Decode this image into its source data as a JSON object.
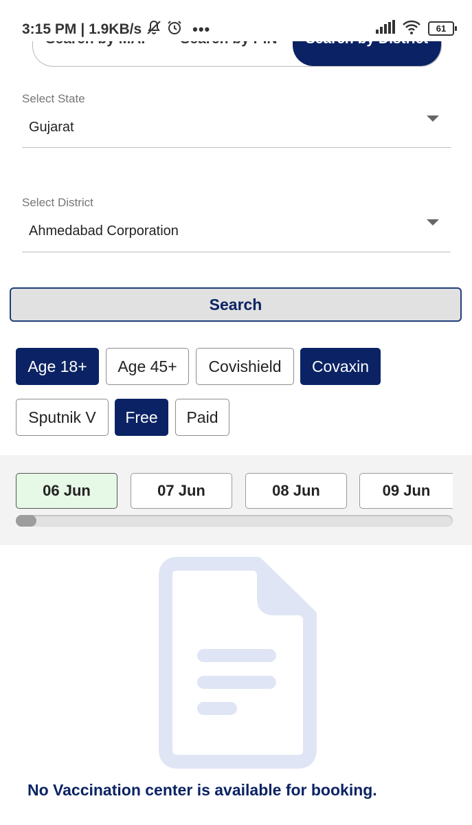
{
  "status_bar": {
    "time": "3:15 PM",
    "speed": "| 1.9KB/s",
    "battery": "61",
    "icons": [
      "mute-notification-icon",
      "alarm-icon",
      "more-dots-icon",
      "signal-icon",
      "wifi-icon",
      "battery-icon"
    ]
  },
  "tabs": {
    "map": "Search by MAP",
    "pin": "Search by PIN",
    "district": "Search by District",
    "active": "district"
  },
  "state_select": {
    "label": "Select State",
    "value": "Gujarat"
  },
  "district_select": {
    "label": "Select District",
    "value": "Ahmedabad Corporation"
  },
  "search_button": "Search",
  "filters": [
    {
      "label": "Age 18+",
      "selected": true
    },
    {
      "label": "Age 45+",
      "selected": false
    },
    {
      "label": "Covishield",
      "selected": false
    },
    {
      "label": "Covaxin",
      "selected": true
    },
    {
      "label": "Sputnik V",
      "selected": false
    },
    {
      "label": "Free",
      "selected": true
    },
    {
      "label": "Paid",
      "selected": false
    }
  ],
  "dates": [
    {
      "label": "06 Jun",
      "selected": true
    },
    {
      "label": "07 Jun",
      "selected": false
    },
    {
      "label": "08 Jun",
      "selected": false
    },
    {
      "label": "09 Jun",
      "selected": false
    }
  ],
  "empty_state": {
    "icon": "document-icon",
    "message": "No Vaccination center is available for booking."
  },
  "colors": {
    "primary": "#0b2364",
    "selected_date_bg": "#e6f8e6",
    "illustration": "#dfe5f4"
  }
}
